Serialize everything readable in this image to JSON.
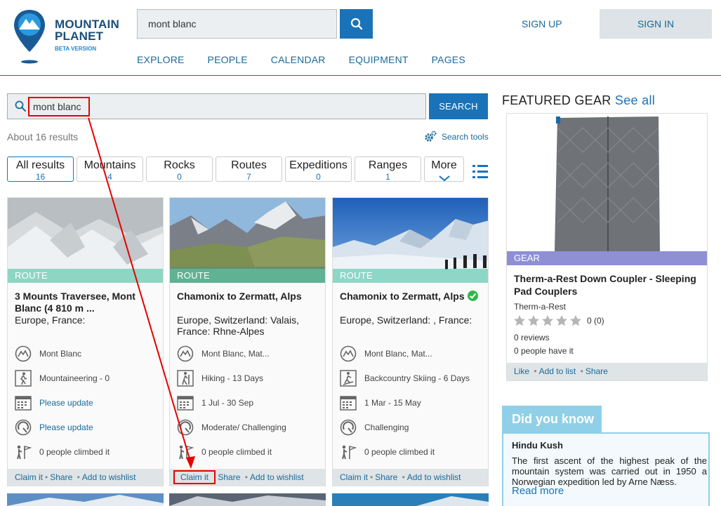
{
  "logo": {
    "line1": "MOUNTAIN",
    "line2": "PLANET",
    "beta": "BETA VERSION"
  },
  "header": {
    "search_value": "mont blanc",
    "nav": [
      "EXPLORE",
      "PEOPLE",
      "CALENDAR",
      "EQUIPMENT",
      "PAGES"
    ],
    "sign_up": "SIGN UP",
    "sign_in": "SIGN IN"
  },
  "search": {
    "query": "mont blanc",
    "button": "SEARCH",
    "results_count": "About 16 results",
    "tools": "Search tools"
  },
  "tabs": [
    {
      "label": "All results",
      "count": "16"
    },
    {
      "label": "Mountains",
      "count": "4"
    },
    {
      "label": "Rocks",
      "count": "0"
    },
    {
      "label": "Routes",
      "count": "7"
    },
    {
      "label": "Expeditions",
      "count": "0"
    },
    {
      "label": "Ranges",
      "count": "1"
    },
    {
      "label": "More"
    }
  ],
  "cards": [
    {
      "badge": "ROUTE",
      "title": "3 Mounts Traversee, Mont Blanc (4 810 m ...",
      "location": "Europe, France:",
      "mountain": "Mont Blanc",
      "activity": "Mountaineering - 0",
      "dates": "Please update",
      "difficulty": "Please update",
      "climbed": "0 people climbed it",
      "footer": [
        "Claim it",
        "Share",
        "Add to wishlist"
      ]
    },
    {
      "badge": "ROUTE",
      "title": "Chamonix to Zermatt, Alps",
      "location": "Europe, Switzerland: Valais, France: Rhne-Alpes",
      "mountain": "Mont Blanc, Mat...",
      "activity": "Hiking - 13 Days",
      "dates": "1 Jul - 30 Sep",
      "difficulty": "Moderate/ Challenging",
      "climbed": "0 people climbed it",
      "footer": [
        "Claim it",
        "Share",
        "Add to wishlist"
      ]
    },
    {
      "badge": "ROUTE",
      "title": "Chamonix to Zermatt, Alps",
      "location": "Europe, Switzerland: , France:",
      "mountain": "Mont Blanc, Mat...",
      "activity": "Backcountry Skiing - 6 Days",
      "dates": "1 Mar - 15 May",
      "difficulty": "Challenging",
      "climbed": "0 people climbed it",
      "footer": [
        "Claim it",
        "Share",
        "Add to wishlist"
      ]
    }
  ],
  "featured": {
    "heading": "FEATURED GEAR",
    "see_all": "See all",
    "badge": "GEAR",
    "title": "Therm-a-Rest Down Coupler - Sleeping Pad Couplers",
    "brand": "Therm-a-Rest",
    "rating": "0 (0)",
    "reviews": "0 reviews",
    "have_it": "0 people have it",
    "footer": [
      "Like",
      "Add to list",
      "Share"
    ]
  },
  "did_you_know": {
    "heading": "Did you know",
    "title": "Hindu Kush",
    "text": "The first ascent of the highest peak of the mountain system was carried out in 1950 a Norwegian expedition led by Arne Næss.",
    "read_more": "Read more"
  },
  "colors": {
    "brand": "#1a73b8",
    "badge_route": "#5ac8aa",
    "badge_gear": "#8f8fd6",
    "highlight": "#e60000"
  }
}
